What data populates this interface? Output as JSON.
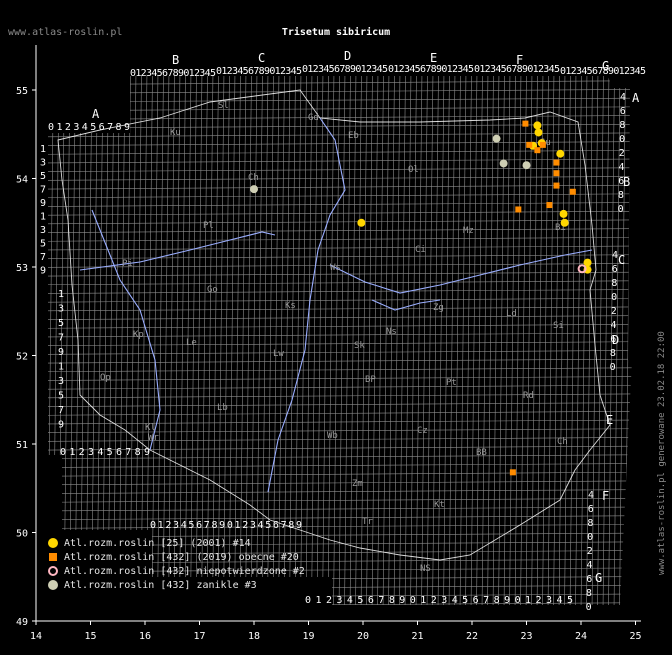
{
  "site": "www.atlas-roslin.pl",
  "title": "Trisetum sibiricum",
  "generated": "www.atlas-roslin.pl generowane 23.02.18 22:00",
  "lon_ticks": [
    "14",
    "15",
    "16",
    "17",
    "18",
    "19",
    "20",
    "21",
    "22",
    "23",
    "24",
    "25"
  ],
  "lat_ticks": [
    "49",
    "50",
    "51",
    "52",
    "53",
    "54",
    "55"
  ],
  "colors": {
    "yellow": "#ffd700",
    "orange": "#ff8c00",
    "pink": "#ffb6c1",
    "gray": "#cfcfb4",
    "grid": "#8c8c8c",
    "river": "#9aaeff",
    "border": "#ffffff",
    "bg": "#000000"
  },
  "legend": [
    {
      "label": "Atl.rozm.roslin [25] (2001) #14",
      "symbol": "yellow-circle"
    },
    {
      "label": "Atl.rozm.roslin [432] (2019) obecne #20",
      "symbol": "orange-square"
    },
    {
      "label": "Atl.rozm.roslin [432] niepotwierdzone #2",
      "symbol": "pink-ring"
    },
    {
      "label": "Atl.rozm.roslin [432] zanikle #3",
      "symbol": "gray-circle"
    }
  ],
  "grid_letters": [
    "A",
    "B",
    "C",
    "D",
    "E",
    "F",
    "G"
  ],
  "digits": "0123456789",
  "regions": [
    "Sl",
    "Ku",
    "Gd",
    "Eb",
    "Ol",
    "Su",
    "Ch",
    "Pl",
    "Bi",
    "Ci",
    "Mz",
    "Ws",
    "Pi",
    "Go",
    "Ks",
    "Kp",
    "Lw",
    "Zg",
    "Le",
    "Ns",
    "Sk",
    "Ld",
    "Si",
    "BP",
    "Pt",
    "Rd",
    "Lb",
    "Wr",
    "Wb",
    "Cz",
    "Kl",
    "Ch",
    "Zm",
    "Kt",
    "Tr",
    "BB",
    "NS",
    "Op"
  ],
  "points": {
    "yellow": [
      [
        23.22,
        54.52
      ],
      [
        23.2,
        54.6
      ],
      [
        23.28,
        54.4
      ],
      [
        23.12,
        54.37
      ],
      [
        23.62,
        54.28
      ],
      [
        23.68,
        53.6
      ],
      [
        23.7,
        53.5
      ],
      [
        24.12,
        53.05
      ],
      [
        24.12,
        52.97
      ],
      [
        19.97,
        53.5
      ]
    ],
    "orange": [
      [
        22.98,
        54.62
      ],
      [
        23.05,
        54.38
      ],
      [
        23.3,
        54.38
      ],
      [
        23.55,
        54.18
      ],
      [
        23.55,
        54.06
      ],
      [
        23.55,
        53.92
      ],
      [
        23.2,
        54.32
      ],
      [
        23.85,
        53.85
      ],
      [
        23.42,
        53.7
      ],
      [
        22.85,
        53.65
      ],
      [
        22.75,
        50.68
      ]
    ],
    "pink": [
      [
        24.02,
        52.98
      ]
    ],
    "gray": [
      [
        22.45,
        54.45
      ],
      [
        22.58,
        54.17
      ],
      [
        23.0,
        54.15
      ],
      [
        18.0,
        53.88
      ]
    ]
  }
}
